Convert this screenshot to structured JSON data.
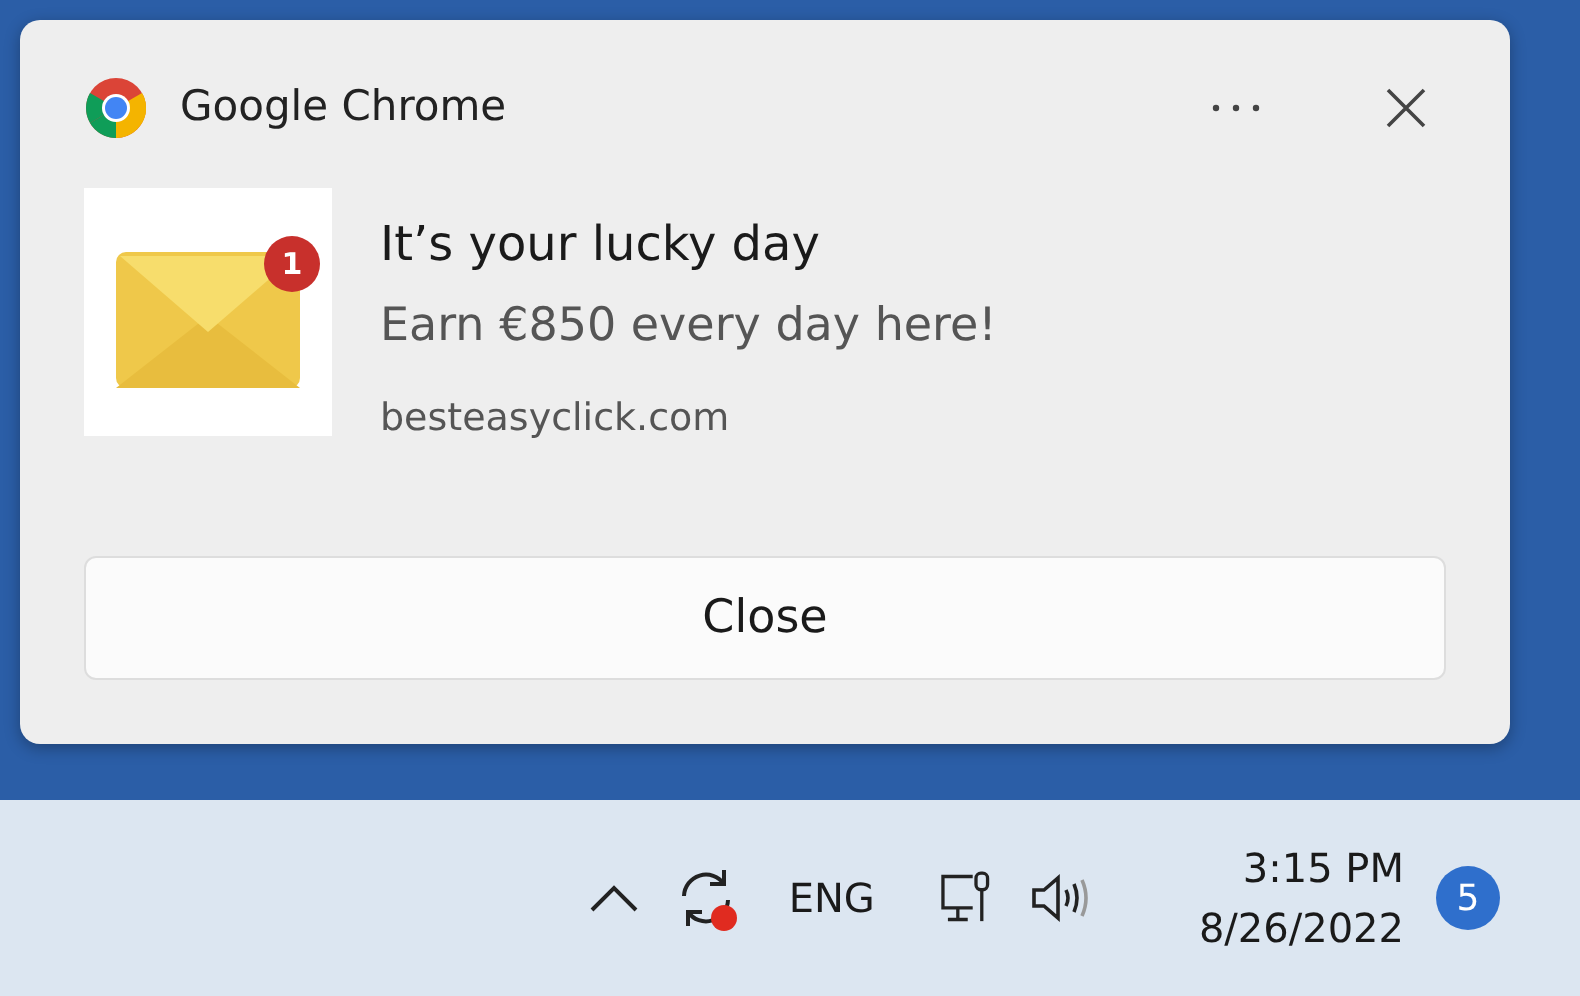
{
  "notification": {
    "app_name": "Google Chrome",
    "image_badge": "1",
    "title": "It’s your lucky day",
    "message": "Earn €850 every day here!",
    "source": "besteasyclick.com",
    "button": "Close"
  },
  "taskbar": {
    "language": "ENG",
    "time": "3:15 PM",
    "date": "8/26/2022",
    "notification_count": "5"
  }
}
